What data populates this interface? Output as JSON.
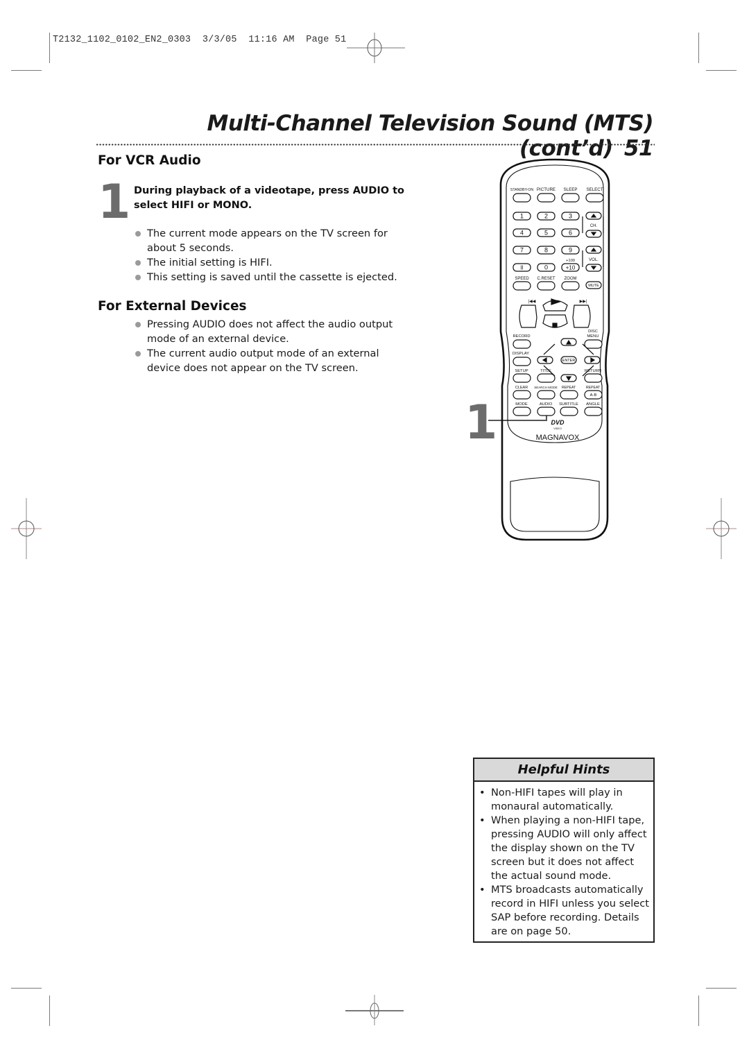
{
  "slug": {
    "file": "T2132_1102_0102_EN2_0303",
    "date": "3/3/05",
    "time": "11:16 AM",
    "page_label": "Page 51"
  },
  "header": {
    "title": "Multi-Channel Television Sound (MTS) (cont’d)",
    "page_number": "51"
  },
  "vcr_audio": {
    "heading": "For VCR Audio",
    "step_number": "1",
    "step_text": "During playback of a videotape, press AUDIO to select HIFI or MONO.",
    "bullets": [
      "The current mode appears on the TV screen for about 5 seconds.",
      "The initial setting is HIFI.",
      "This setting is saved until the cassette is ejected."
    ]
  },
  "external_devices": {
    "heading": "For External Devices",
    "bullets": [
      "Pressing AUDIO does not affect the audio output mode of an external device.",
      "The current audio output mode of an external device does not appear on the TV screen."
    ]
  },
  "remote": {
    "callout_number": "1",
    "callout_target": "AUDIO",
    "brand": "MAGNAVOX",
    "logo_dvd": "DVD",
    "logo_video": "VIDEO",
    "labels": {
      "standby": "STANDBY-ON",
      "picture": "PICTURE",
      "sleep": "SLEEP",
      "select": "SELECT",
      "n1": "1",
      "n2": "2",
      "n3": "3",
      "n4": "4",
      "n5": "5",
      "n6": "6",
      "n7": "7",
      "n8": "8",
      "n9": "9",
      "n0": "0",
      "pause": "II",
      "plus100": "+100",
      "plus10": "+10",
      "ch": "CH.",
      "vol": "VOL.",
      "speed": "SPEED",
      "creset": "C.RESET",
      "zoom": "ZOOM",
      "mute": "MUTE",
      "play": "PLAY",
      "stop": "STOP",
      "record": "RECORD",
      "disc": "DISC",
      "menu": "MENU",
      "display": "DISPLAY",
      "enter": "ENTER",
      "setup": "SETUP",
      "title": "TITLE",
      "return": "RETURN",
      "clear": "CLEAR",
      "search_mode": "SEARCH MODE",
      "repeat": "REPEAT",
      "repeat2": "REPEAT",
      "ab": "A-B",
      "mode": "MODE",
      "audio": "AUDIO",
      "subtitle": "SUBTITLE",
      "angle": "ANGLE"
    }
  },
  "helpful_hints": {
    "title": "Helpful Hints",
    "items": [
      "Non-HIFI tapes will play in monaural automatically.",
      "When playing a non-HIFI tape, pressing AUDIO will only affect the display shown on the TV screen but it does not affect the actual sound mode.",
      "MTS broadcasts automatically record in HIFI unless you select SAP before recording. Details are on page 50."
    ]
  }
}
